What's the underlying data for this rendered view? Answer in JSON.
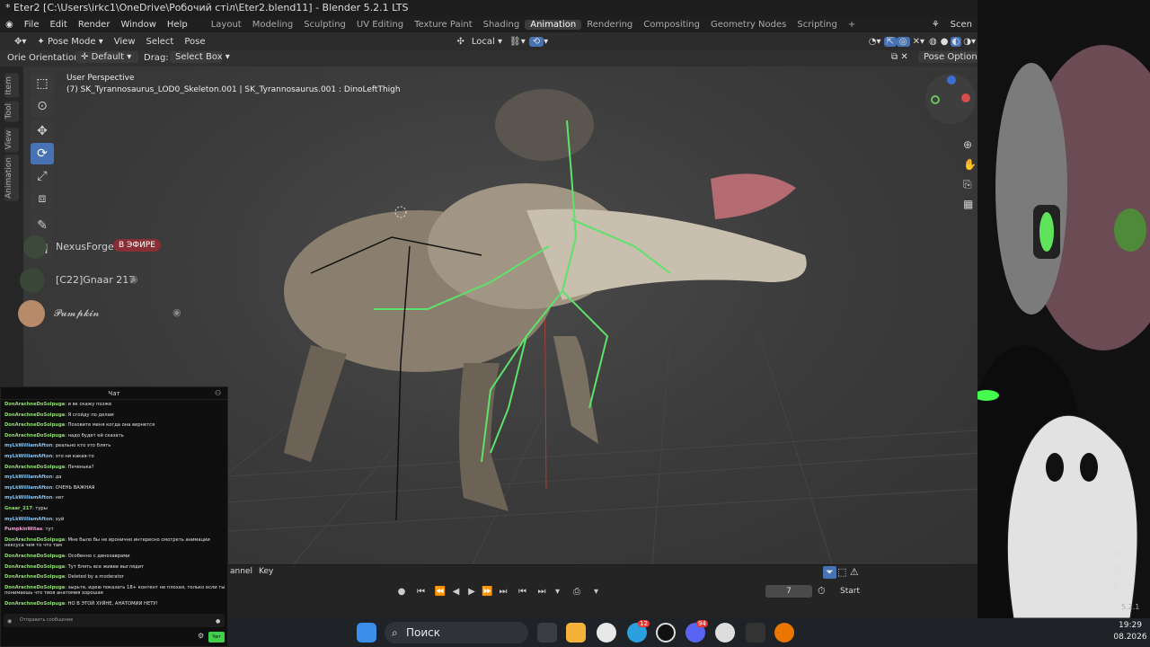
{
  "window": {
    "title": "* Eter2 [C:\\Users\\irkc1\\OneDrive\\Робочий стіл\\Eter2.blend11] - Blender 5.2.1 LTS"
  },
  "menu": {
    "items": [
      "File",
      "Edit",
      "Render",
      "Window",
      "Help"
    ],
    "workspaces": [
      "Layout",
      "Modeling",
      "Sculpting",
      "UV Editing",
      "Texture Paint",
      "Shading",
      "Animation",
      "Rendering",
      "Compositing",
      "Geometry Nodes",
      "Scripting"
    ],
    "active_workspace": "Animation",
    "scene_label": "Scen"
  },
  "header": {
    "mode": "Pose Mode",
    "view": "View",
    "select": "Select",
    "pose": "Pose",
    "pivot": "Local"
  },
  "tool_settings": {
    "orientation_label": "Orientation:",
    "orientation_value": "Default",
    "drag_label": "Drag:",
    "drag_value": "Select Box",
    "pose_options": "Pose Options",
    "left_cut": "Orie"
  },
  "viewport": {
    "perspective": "User Perspective",
    "active_info": "(7) SK_Tyrannosaurus_LOD0_Skeleton.001 | SK_Tyrannosaurus.001 : DinoLeftThigh"
  },
  "side_tabs": [
    "Item",
    "Tool",
    "View",
    "Animation"
  ],
  "overlays": {
    "nexus_name": "NexusForge",
    "live_badge": "В ЭФИРЕ",
    "gnaar": "[C22]Gnaar 217",
    "pumpkin": "𝓟𝓾𝓶𝓹𝓴𝓲𝓷"
  },
  "timeline": {
    "channel": "annel",
    "key": "Key",
    "frame": "7",
    "start": "Start",
    "right_values": [
      "0",
      "0"
    ],
    "version": "5.2.1"
  },
  "chat": {
    "title": "Чат",
    "placeholder": "Отправить сообщение",
    "send": "Чат",
    "messages": [
      {
        "user": "DonArachneDoSolpuga",
        "text": "и вк скажу позже"
      },
      {
        "user": "DonArachneDoSolpuga",
        "text": "Я сгойду по делам"
      },
      {
        "user": "DonArachneDoSolpuga",
        "text": "Позовите меня когда она вернется"
      },
      {
        "user": "DonArachneDoSolpuga",
        "text": "надо будет ей сказать"
      },
      {
        "user": "myLkWilliamAfton",
        "text": "реально кто это блять"
      },
      {
        "user": "myLkWilliamAfton",
        "text": "это ни какая-то"
      },
      {
        "user": "DonArachneDoSolpuga",
        "text": "Печенька?"
      },
      {
        "user": "myLkWilliamAfton",
        "text": "да"
      },
      {
        "user": "myLkWilliamAfton",
        "text": "ОЧЕНЬ ВАЖНАЯ"
      },
      {
        "user": "myLkWilliamAfton",
        "text": "нет"
      },
      {
        "user": "Gnaar_217",
        "text": "туры"
      },
      {
        "user": "myLkWilliamAfton",
        "text": "хуй"
      },
      {
        "user": "PumpkinWitas",
        "text": "тут"
      },
      {
        "user": "DonArachneDoSolpuga",
        "text": "Мне было бы не иронично интересно смотреть анимации нексуса чем то что там"
      },
      {
        "user": "DonArachneDoSolpuga",
        "text": "Особенно с динозаврами"
      },
      {
        "user": "DonArachneDoSolpuga",
        "text": "Тут блять все живее выглядит"
      },
      {
        "user": "DonArachneDoSolpuga",
        "text": "Deleted by a moderator"
      },
      {
        "user": "DonArachneDoSolpuga",
        "text": "зырьте, идею показать 18+ контент не плохая, только если ты понимаешь что твоя анатомия хорошая"
      },
      {
        "user": "DonArachneDoSolpuga",
        "text": "НО В ЭТОЙ ХУЙНЕ, АНАТОМИИ НЕТУ!"
      }
    ]
  },
  "taskbar": {
    "search": "Поиск",
    "time": "19:29",
    "date": "08.2026",
    "badge_telegram": "12",
    "badge_discord": "94"
  },
  "colors": {
    "accent": "#4772b3",
    "bone": "#4fdc5a",
    "viewport": "#3a3a3a"
  }
}
